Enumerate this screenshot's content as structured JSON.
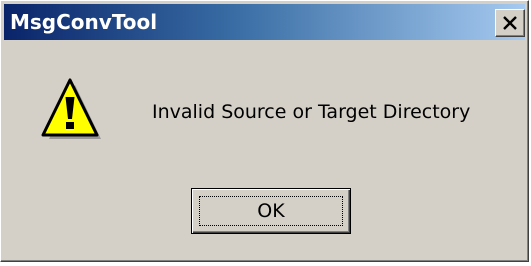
{
  "window": {
    "title": "MsgConvTool"
  },
  "dialog": {
    "message": "Invalid Source or Target Directory",
    "icon": "warning-icon",
    "ok_label": "OK"
  },
  "colors": {
    "titlebar_start": "#0a246a",
    "titlebar_end": "#a6caf0",
    "face": "#d4d0c8",
    "warning_yellow": "#ffff00"
  }
}
